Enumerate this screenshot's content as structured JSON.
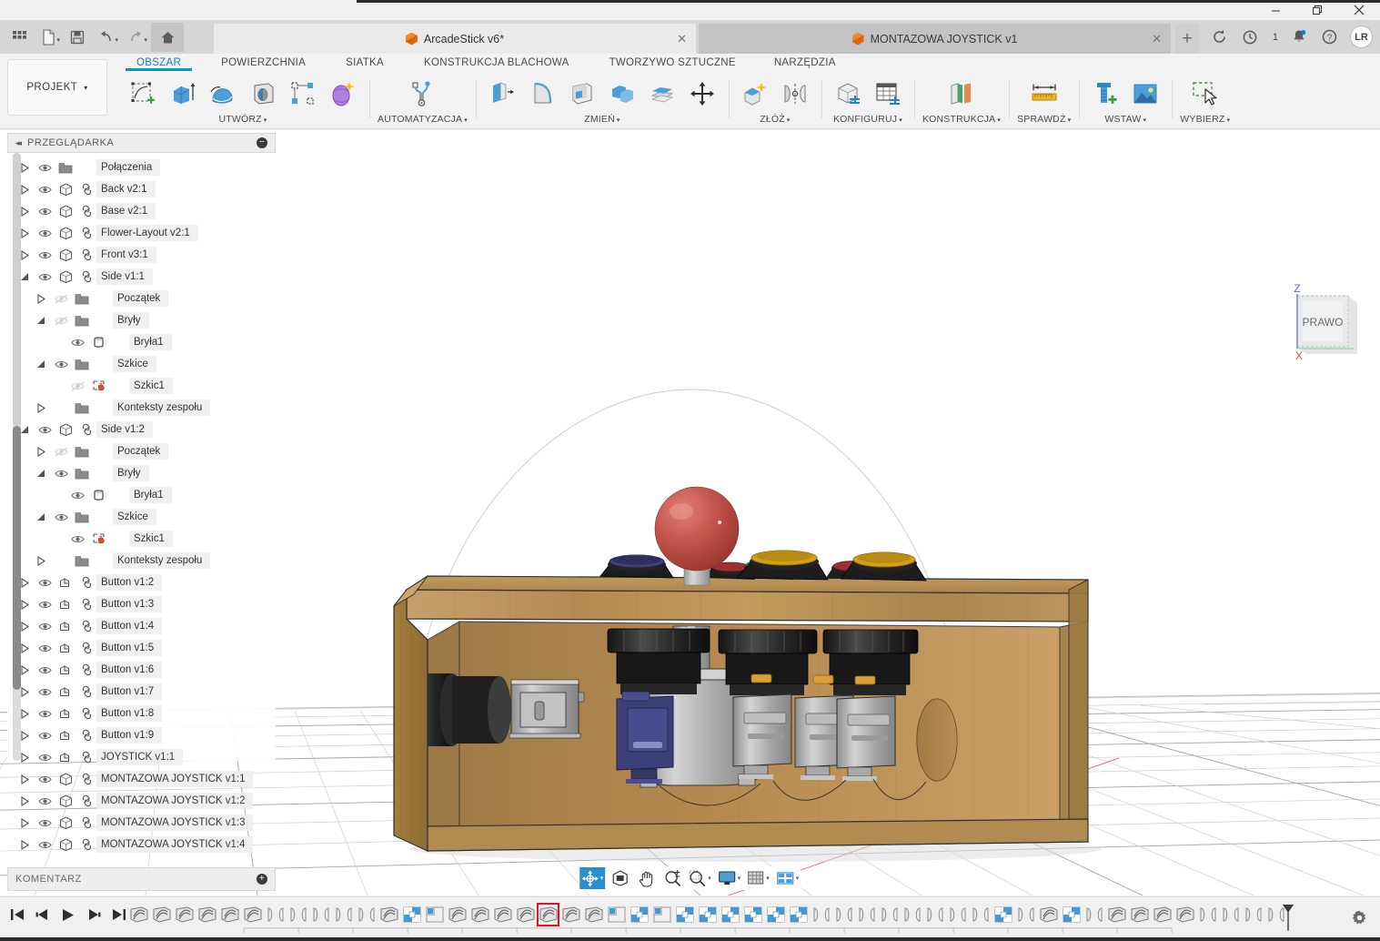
{
  "window": {
    "minimize_label": "─",
    "restore_label": "❐",
    "close_label": "✕"
  },
  "appbar": {
    "buttons": [
      {
        "name": "grid-apps-icon",
        "label": "",
        "caret": false
      },
      {
        "name": "new-document-icon",
        "label": "",
        "caret": true
      },
      {
        "name": "save-icon",
        "label": "",
        "caret": false
      },
      {
        "name": "undo-icon",
        "label": "",
        "caret": true
      },
      {
        "name": "redo-icon",
        "label": "",
        "caret": true
      },
      {
        "name": "home-icon",
        "label": "",
        "caret": false
      }
    ]
  },
  "tabs": {
    "documents": [
      {
        "title": "ArcadeStick v6*",
        "close": "✕",
        "active": true
      },
      {
        "title": "MONTAZOWA JOYSTICK v1",
        "close": "✕",
        "active": false
      }
    ],
    "add_tab_label": "+",
    "job_count": "1",
    "avatar_initials": "LR"
  },
  "ribbon": {
    "project_button": "PROJEKT",
    "project_caret": "▾",
    "tabs": [
      {
        "label": "OBSZAR",
        "active": true
      },
      {
        "label": "POWIERZCHNIA",
        "active": false
      },
      {
        "label": "SIATKA",
        "active": false
      },
      {
        "label": "KONSTRUKCJA BLACHOWA",
        "active": false
      },
      {
        "label": "TWORZYWO SZTUCZNE",
        "active": false
      },
      {
        "label": "NARZĘDZIA",
        "active": false
      }
    ],
    "groups": [
      {
        "label": "UTWÓRZ",
        "caret": "▾",
        "items": [
          {
            "name": "new-sketch-icon"
          },
          {
            "name": "extrude-icon"
          },
          {
            "name": "revolve-icon"
          },
          {
            "name": "hole-icon"
          },
          {
            "name": "pattern-icon"
          },
          {
            "name": "form-icon"
          }
        ]
      },
      {
        "label": "AUTOMATYZACJA",
        "caret": "▾",
        "items": [
          {
            "name": "automation-icon"
          }
        ]
      },
      {
        "label": "ZMIEŃ",
        "caret": "▾",
        "items": [
          {
            "name": "press-pull-icon"
          },
          {
            "name": "fillet-icon"
          },
          {
            "name": "shell-icon"
          },
          {
            "name": "combine-icon"
          },
          {
            "name": "split-face-icon"
          },
          {
            "name": "move-copy-icon"
          }
        ]
      },
      {
        "label": "ZŁÓŻ",
        "caret": "▾",
        "items": [
          {
            "name": "new-component-icon"
          },
          {
            "name": "joint-icon"
          }
        ]
      },
      {
        "label": "KONFIGURUJ",
        "caret": "▾",
        "items": [
          {
            "name": "configuration-icon"
          },
          {
            "name": "configuration-table-icon"
          }
        ]
      },
      {
        "label": "KONSTRUKCJA",
        "caret": "▾",
        "items": [
          {
            "name": "construction-plane-icon"
          }
        ]
      },
      {
        "label": "SPRAWDŹ",
        "caret": "▾",
        "items": [
          {
            "name": "measure-icon"
          }
        ]
      },
      {
        "label": "WSTAW",
        "caret": "▾",
        "items": [
          {
            "name": "insert-mcmaster-icon"
          },
          {
            "name": "insert-image-icon"
          }
        ]
      },
      {
        "label": "WYBIERZ",
        "caret": "▾",
        "items": [
          {
            "name": "select-window-icon"
          }
        ]
      }
    ]
  },
  "browser": {
    "title": "PRZEGLĄDARKA",
    "collapse_icon": "◂◂",
    "minimize_icon": "−",
    "tree": [
      {
        "label": "Połączenia",
        "indent": 1,
        "arrow": "closed",
        "eye": "visible",
        "icon": "folder",
        "link": false
      },
      {
        "label": "Back v2:1",
        "indent": 1,
        "arrow": "closed",
        "eye": "visible",
        "icon": "component",
        "link": true
      },
      {
        "label": "Base v2:1",
        "indent": 1,
        "arrow": "closed",
        "eye": "visible",
        "icon": "component",
        "link": true
      },
      {
        "label": "Flower-Layout v2:1",
        "indent": 1,
        "arrow": "closed",
        "eye": "visible",
        "icon": "component",
        "link": true
      },
      {
        "label": "Front v3:1",
        "indent": 1,
        "arrow": "closed",
        "eye": "visible",
        "icon": "component",
        "link": true
      },
      {
        "label": "Side v1:1",
        "indent": 1,
        "arrow": "open",
        "eye": "visible",
        "icon": "component",
        "link": true
      },
      {
        "label": "Początek",
        "indent": 2,
        "arrow": "closed",
        "eye": "hidden",
        "icon": "folder",
        "link": false
      },
      {
        "label": "Bryły",
        "indent": 2,
        "arrow": "open",
        "eye": "hidden",
        "icon": "folder",
        "link": false
      },
      {
        "label": "Bryła1",
        "indent": 3,
        "arrow": "none",
        "eye": "visible",
        "icon": "body",
        "link": false
      },
      {
        "label": "Szkice",
        "indent": 2,
        "arrow": "open",
        "eye": "visible",
        "icon": "folder",
        "link": false
      },
      {
        "label": "Szkic1",
        "indent": 3,
        "arrow": "none",
        "eye": "hidden",
        "icon": "sketch",
        "link": false
      },
      {
        "label": "Konteksty zespołu",
        "indent": 2,
        "arrow": "closed",
        "eye": "none",
        "icon": "folder",
        "link": false
      },
      {
        "label": "Side v1:2",
        "indent": 1,
        "arrow": "open",
        "eye": "visible",
        "icon": "component",
        "link": true
      },
      {
        "label": "Początek",
        "indent": 2,
        "arrow": "closed",
        "eye": "hidden",
        "icon": "folder",
        "link": false
      },
      {
        "label": "Bryły",
        "indent": 2,
        "arrow": "open",
        "eye": "visible",
        "icon": "folder",
        "link": false
      },
      {
        "label": "Bryła1",
        "indent": 3,
        "arrow": "none",
        "eye": "visible",
        "icon": "body",
        "link": false
      },
      {
        "label": "Szkice",
        "indent": 2,
        "arrow": "open",
        "eye": "visible",
        "icon": "folder",
        "link": false
      },
      {
        "label": "Szkic1",
        "indent": 3,
        "arrow": "none",
        "eye": "visible",
        "icon": "sketch",
        "link": false
      },
      {
        "label": "Konteksty zespołu",
        "indent": 2,
        "arrow": "closed",
        "eye": "none",
        "icon": "folder",
        "link": false
      },
      {
        "label": "Button v1:2",
        "indent": 1,
        "arrow": "closed",
        "eye": "visible",
        "icon": "assembly",
        "link": true
      },
      {
        "label": "Button v1:3",
        "indent": 1,
        "arrow": "closed",
        "eye": "visible",
        "icon": "assembly",
        "link": true
      },
      {
        "label": "Button v1:4",
        "indent": 1,
        "arrow": "closed",
        "eye": "visible",
        "icon": "assembly",
        "link": true
      },
      {
        "label": "Button v1:5",
        "indent": 1,
        "arrow": "closed",
        "eye": "visible",
        "icon": "assembly",
        "link": true
      },
      {
        "label": "Button v1:6",
        "indent": 1,
        "arrow": "closed",
        "eye": "visible",
        "icon": "assembly",
        "link": true
      },
      {
        "label": "Button v1:7",
        "indent": 1,
        "arrow": "closed",
        "eye": "visible",
        "icon": "assembly",
        "link": true
      },
      {
        "label": "Button v1:8",
        "indent": 1,
        "arrow": "closed",
        "eye": "visible",
        "icon": "assembly",
        "link": true
      },
      {
        "label": "Button v1:9",
        "indent": 1,
        "arrow": "closed",
        "eye": "visible",
        "icon": "assembly",
        "link": true
      },
      {
        "label": "JOYSTICK v1:1",
        "indent": 1,
        "arrow": "closed",
        "eye": "visible",
        "icon": "assembly",
        "link": true
      },
      {
        "label": "MONTAZOWA JOYSTICK v1:1",
        "indent": 1,
        "arrow": "closed",
        "eye": "visible",
        "icon": "component",
        "link": true
      },
      {
        "label": "MONTAZOWA JOYSTICK v1:2",
        "indent": 1,
        "arrow": "closed",
        "eye": "visible",
        "icon": "component",
        "link": true
      },
      {
        "label": "MONTAZOWA JOYSTICK v1:3",
        "indent": 1,
        "arrow": "closed",
        "eye": "visible",
        "icon": "component",
        "link": true
      },
      {
        "label": "MONTAZOWA JOYSTICK v1:4",
        "indent": 1,
        "arrow": "closed",
        "eye": "visible",
        "icon": "component",
        "link": true
      }
    ]
  },
  "comment_panel": {
    "title": "KOMENTARZ",
    "add_icon": "+"
  },
  "viewport": {
    "viewcube_face": "PRAWO",
    "axis_z": "Z",
    "axis_x": "X",
    "background_color": "#ffffff",
    "grid_color": "#c8c8c8",
    "model": {
      "name": "arcade-stick-enclosure",
      "wood_color": "#b08b52",
      "joystick_ball_color": "#c0493f",
      "button_ring_colors": [
        "#3b3f76",
        "#9c2f2f",
        "#2f7a3a",
        "#d4a017",
        "#9c2f2f",
        "#d4a017"
      ],
      "microswitch_color": "#3c3f78"
    },
    "toolbar": [
      {
        "name": "orbit-icon",
        "selected": true,
        "caret": "▾"
      },
      {
        "name": "view-front-icon",
        "selected": false,
        "caret": ""
      },
      {
        "name": "pan-icon",
        "selected": false,
        "caret": ""
      },
      {
        "name": "zoom-icon",
        "selected": false,
        "caret": ""
      },
      {
        "name": "zoom-window-icon",
        "selected": false,
        "caret": "▾"
      },
      {
        "name": "display-settings-icon",
        "selected": false,
        "caret": "▾"
      },
      {
        "name": "grid-snap-icon",
        "selected": false,
        "caret": "▾"
      },
      {
        "name": "viewport-layout-icon",
        "selected": false,
        "caret": "▾"
      }
    ]
  },
  "timeline": {
    "playback": [
      {
        "name": "jump-to-start-button",
        "glyph": "start"
      },
      {
        "name": "step-back-button",
        "glyph": "stepback"
      },
      {
        "name": "play-button",
        "glyph": "play"
      },
      {
        "name": "step-forward-button",
        "glyph": "stepfwd"
      },
      {
        "name": "jump-to-end-button",
        "glyph": "end"
      }
    ],
    "settings_icon": "gear-icon",
    "marked_index": 18,
    "features": [
      "joint",
      "joint",
      "joint",
      "joint",
      "joint",
      "joint",
      "asbuilt",
      "asbuilt",
      "asbuilt",
      "asbuilt",
      "asbuilt",
      "joint",
      "component",
      "rigid",
      "joint",
      "joint",
      "joint",
      "joint",
      "joint",
      "joint",
      "joint",
      "rigid",
      "component",
      "rigid",
      "component",
      "component",
      "component",
      "component",
      "component",
      "component",
      "asbuilt",
      "asbuilt",
      "asbuilt",
      "asbuilt",
      "asbuilt",
      "asbuilt",
      "asbuilt",
      "asbuilt",
      "component",
      "asbuilt",
      "joint",
      "component",
      "asbuilt",
      "joint",
      "joint",
      "joint",
      "joint",
      "asbuilt",
      "asbuilt",
      "asbuilt",
      "asbuilt"
    ]
  }
}
